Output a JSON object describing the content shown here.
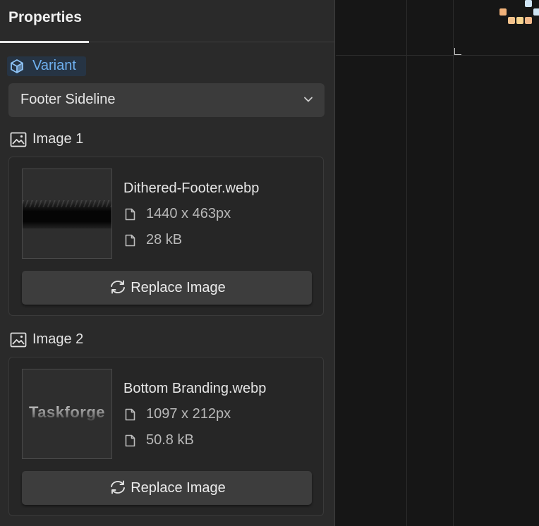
{
  "panel": {
    "title": "Properties",
    "variant": {
      "label": "Variant",
      "icon": "cube-icon",
      "selected": "Footer Sideline"
    }
  },
  "images": [
    {
      "section_label": "Image 1",
      "file_name": "Dithered-Footer.webp",
      "dimensions": "1440 x 463px",
      "size": "28 kB",
      "button_label": "Replace Image"
    },
    {
      "section_label": "Image 2",
      "file_name": "Bottom Branding.webp",
      "dimensions": "1097 x 212px",
      "size": "50.8 kB",
      "button_label": "Replace Image",
      "thumbnail_text": "Taskforge"
    }
  ],
  "colors": {
    "accent": "#6fb0ef",
    "panel_bg": "#2a2a2a",
    "canvas_bg": "#161616"
  }
}
